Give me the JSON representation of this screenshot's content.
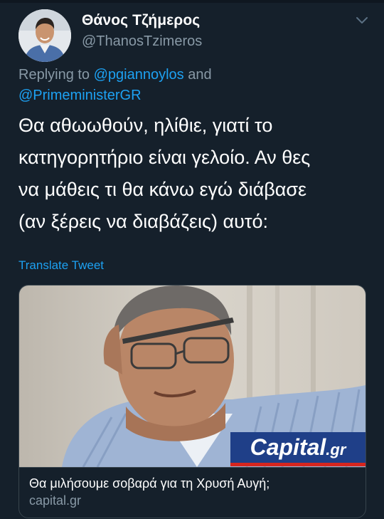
{
  "theme": {
    "background": "#15202b",
    "text": "#ffffff",
    "secondary_text": "#8899a6",
    "link": "#1da1f2",
    "border": "#38444d"
  },
  "author": {
    "display_name": "Θάνος Τζήμερος",
    "handle": "@ThanosTzimeros",
    "avatar_icon": "profile-photo"
  },
  "menu": {
    "icon": "chevron-down-icon"
  },
  "reply": {
    "prefix": "Replying to",
    "user1": "@pgiannoylos",
    "joiner": "and",
    "user2": "@PrimeministerGR"
  },
  "tweet": {
    "lines": [
      "Θα αθωωθούν, ηλίθιε, γιατί το",
      "κατηγορητήριο είναι γελοίο. Αν θες",
      "να μάθεις τι θα κάνω εγώ διάβασε",
      "(αν ξέρεις να διαβάζεις) αυτό:"
    ],
    "translate_label": "Translate Tweet"
  },
  "card": {
    "brand_main": "Capital",
    "brand_suffix": ".gr",
    "brand_color": "#1f3f88",
    "brand_accent": "#d6261f",
    "title": "Θα μιλήσουμε σοβαρά για τη Χρυσή Αυγή;",
    "domain": "capital.gr"
  }
}
